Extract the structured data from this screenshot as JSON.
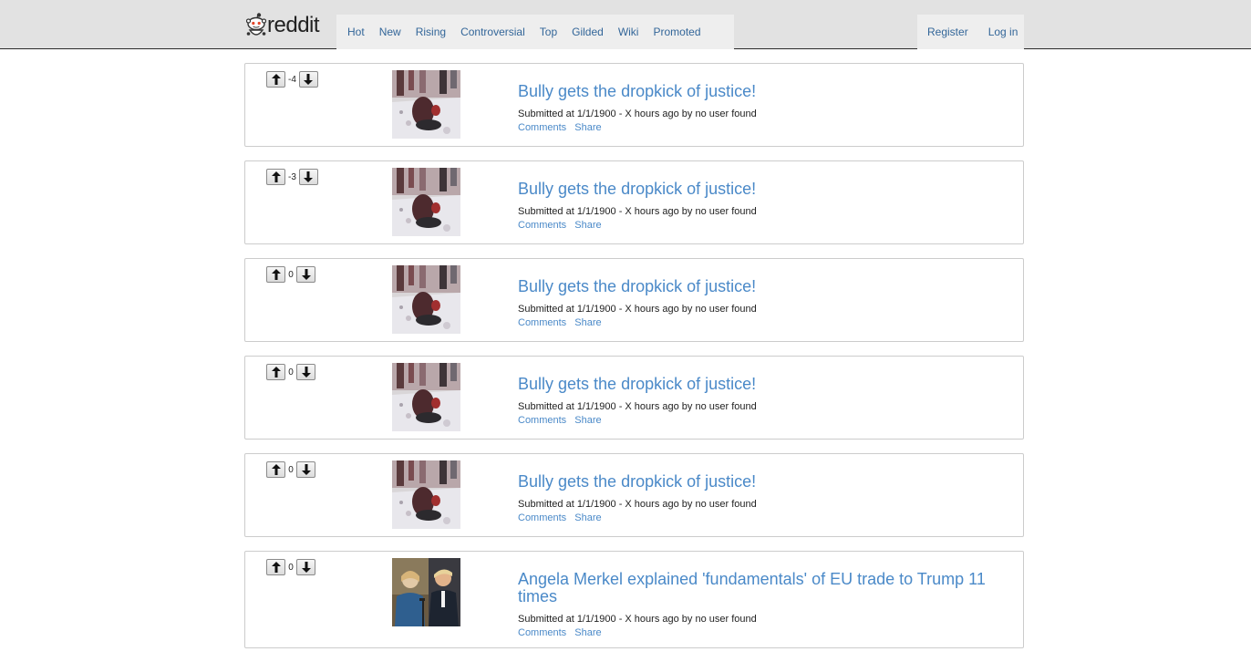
{
  "header": {
    "brand": "reddit",
    "nav": [
      "Hot",
      "New",
      "Rising",
      "Controversial",
      "Top",
      "Gilded",
      "Wiki",
      "Promoted"
    ],
    "account": [
      "Register",
      "Log in"
    ]
  },
  "posts": [
    {
      "score": "-4",
      "title": "Bully gets the dropkick of justice!",
      "meta": "Submitted at 1/1/1900 - X hours ago by no user found",
      "comments": "Comments",
      "share": "Share",
      "thumbnail": "snow-scene-thumbnail"
    },
    {
      "score": "-3",
      "title": "Bully gets the dropkick of justice!",
      "meta": "Submitted at 1/1/1900 - X hours ago by no user found",
      "comments": "Comments",
      "share": "Share",
      "thumbnail": "snow-scene-thumbnail"
    },
    {
      "score": "0",
      "title": "Bully gets the dropkick of justice!",
      "meta": "Submitted at 1/1/1900 - X hours ago by no user found",
      "comments": "Comments",
      "share": "Share",
      "thumbnail": "snow-scene-thumbnail"
    },
    {
      "score": "0",
      "title": "Bully gets the dropkick of justice!",
      "meta": "Submitted at 1/1/1900 - X hours ago by no user found",
      "comments": "Comments",
      "share": "Share",
      "thumbnail": "snow-scene-thumbnail"
    },
    {
      "score": "0",
      "title": "Bully gets the dropkick of justice!",
      "meta": "Submitted at 1/1/1900 - X hours ago by no user found",
      "comments": "Comments",
      "share": "Share",
      "thumbnail": "snow-scene-thumbnail"
    },
    {
      "score": "0",
      "title": "Angela Merkel explained 'fundamentals' of EU trade to Trump 11 times",
      "meta": "Submitted at 1/1/1900 - X hours ago by no user found",
      "comments": "Comments",
      "share": "Share",
      "thumbnail": "press-conference-thumbnail"
    }
  ],
  "icons": {
    "upvote": "arrow-up-icon",
    "downvote": "arrow-down-icon",
    "logo": "reddit-alien-icon"
  },
  "colors": {
    "link": "#4a89c8",
    "nav_link": "#336699",
    "topbar": "#e2e2e2"
  }
}
